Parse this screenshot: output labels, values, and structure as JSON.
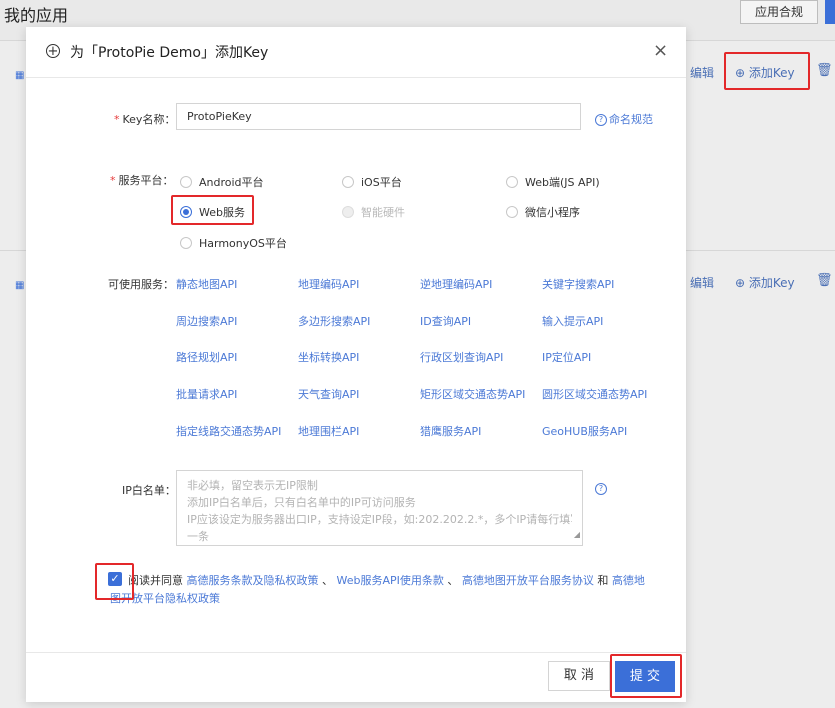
{
  "background": {
    "page_title": "我的应用",
    "top_button": "应用合规",
    "rows": [
      {
        "edit": "编辑",
        "add_key": "添加Key"
      },
      {
        "edit": "编辑",
        "add_key": "添加Key"
      }
    ]
  },
  "modal": {
    "title": "为「ProtoPie Demo」添加Key",
    "close": "×",
    "key_name": {
      "label": "Key名称：",
      "value": "ProtoPieKey",
      "help": "命名规范"
    },
    "platform": {
      "label": "服务平台：",
      "options": [
        {
          "label": "Android平台",
          "checked": false,
          "disabled": false
        },
        {
          "label": "iOS平台",
          "checked": false,
          "disabled": false
        },
        {
          "label": "Web端(JS API)",
          "checked": false,
          "disabled": false
        },
        {
          "label": "Web服务",
          "checked": true,
          "disabled": false
        },
        {
          "label": "智能硬件",
          "checked": false,
          "disabled": true
        },
        {
          "label": "微信小程序",
          "checked": false,
          "disabled": false
        },
        {
          "label": "HarmonyOS平台",
          "checked": false,
          "disabled": false
        }
      ]
    },
    "services": {
      "label": "可使用服务：",
      "items": [
        "静态地图API",
        "地理编码API",
        "逆地理编码API",
        "关键字搜索API",
        "周边搜索API",
        "多边形搜索API",
        "ID查询API",
        "输入提示API",
        "路径规划API",
        "坐标转换API",
        "行政区划查询API",
        "IP定位API",
        "批量请求API",
        "天气查询API",
        "矩形区域交通态势API",
        "圆形区域交通态势API",
        "指定线路交通态势API",
        "地理围栏API",
        "猎鹰服务API",
        "GeoHUB服务API"
      ]
    },
    "ip_whitelist": {
      "label": "IP白名单：",
      "placeholder_lines": [
        "非必填，留空表示无IP限制",
        "添加IP白名单后，只有白名单中的IP可访问服务",
        "IP应该设定为服务器出口IP，支持设定IP段，如:202.202.2.*，多个IP请每行填写",
        "一条"
      ]
    },
    "agreement": {
      "prefix": "阅读并同意",
      "link1": "高德服务条款及隐私权政策",
      "sep1": "、",
      "link2": "Web服务API使用条款",
      "sep2": "、",
      "link3": "高德地图开放平台服务协议",
      "and": "和",
      "link4": "高德地图开放平台隐私权政策",
      "checked": true
    },
    "cancel": "取 消",
    "submit": "提 交"
  },
  "colors": {
    "primary": "#3b6fd8",
    "link": "#4b79d6",
    "highlight": "#e3282a",
    "required": "#e63a3a"
  }
}
